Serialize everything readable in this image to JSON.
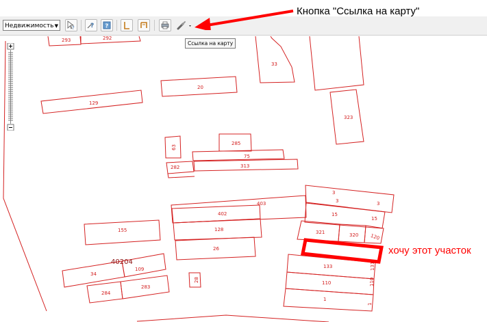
{
  "toolbar": {
    "layer_select": "Недвижимость",
    "tooltip": "Ссылка на карту"
  },
  "annotations": {
    "top": "Кнопка \"Ссылка на карту\"",
    "right": "хочу этот участок"
  },
  "parcels": {
    "p293": "293",
    "p292": "292",
    "p33": "33",
    "p20": "20",
    "p129": "129",
    "p323": "323",
    "p63": "63",
    "p285": "285",
    "p75": "75",
    "p313": "313",
    "p282": "282",
    "p3a": "3",
    "p3b": "3",
    "p3c": "3",
    "p403": "403",
    "p402": "402",
    "p15a": "15",
    "p15b": "15",
    "p155": "155",
    "p128": "128",
    "p321": "321",
    "p320": "320",
    "p120": "120",
    "p26": "26",
    "p40204": "40204",
    "p109": "109",
    "p34": "34",
    "p133": "133",
    "p131": "131",
    "p28": "28",
    "p284": "284",
    "p283": "283",
    "p110a": "110",
    "p110b": "110",
    "p1a": "1",
    "p1b": "1"
  },
  "colors": {
    "parcel_outline": "#d42020",
    "highlight": "#ff0000",
    "arrow": "#ff0000"
  }
}
